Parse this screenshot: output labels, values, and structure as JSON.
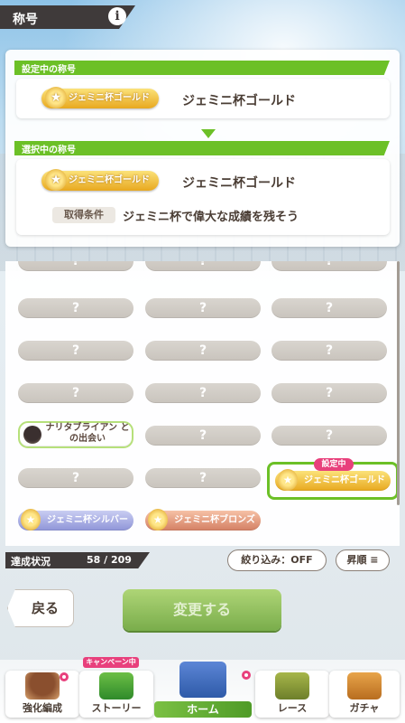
{
  "header": {
    "title": "称号"
  },
  "current": {
    "section_label": "設定中の称号",
    "badge_text": "ジェミニ杯ゴールド",
    "name": "ジェミニ杯ゴールド"
  },
  "selected": {
    "section_label": "選択中の称号",
    "badge_text": "ジェミニ杯ゴールド",
    "name": "ジェミニ杯ゴールド",
    "condition_label": "取得条件",
    "condition_text": "ジェミニ杯で偉大な成績を残そう"
  },
  "grid": {
    "unknown": "?",
    "narita_label": "ナリタブライアン との出会い",
    "set_tag": "設定中",
    "gold_label": "ジェミニ杯ゴールド",
    "silver_label": "ジェミニ杯シルバー",
    "bronze_label": "ジェミニ杯ブロンズ"
  },
  "status": {
    "label": "達成状況",
    "value": "58 / 209"
  },
  "filter": {
    "label": "絞り込み：OFF"
  },
  "sort": {
    "label": "昇順"
  },
  "actions": {
    "back": "戻る",
    "change": "変更する"
  },
  "nav": {
    "campaign": "キャンペーン中",
    "items": [
      "強化編成",
      "ストーリー",
      "ホーム",
      "レース",
      "ガチャ"
    ]
  },
  "colors": {
    "accent": "#6cc027",
    "gold": "#e8a81f",
    "pink": "#e8407c"
  }
}
